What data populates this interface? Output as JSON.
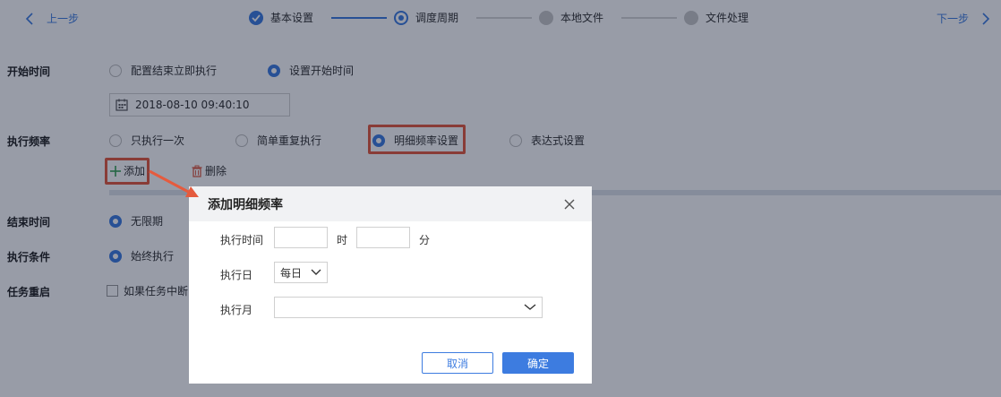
{
  "nav": {
    "prev_label": "上一步",
    "next_label": "下一步"
  },
  "steps": [
    {
      "label": "基本设置",
      "status": "done"
    },
    {
      "label": "调度周期",
      "status": "current"
    },
    {
      "label": "本地文件",
      "status": "todo"
    },
    {
      "label": "文件处理",
      "status": "todo"
    }
  ],
  "form": {
    "start_time": {
      "label": "开始时间",
      "options": [
        {
          "label": "配置结束立即执行",
          "checked": false
        },
        {
          "label": "设置开始时间",
          "checked": true
        }
      ],
      "datetime_value": "2018-08-10 09:40:10"
    },
    "frequency": {
      "label": "执行频率",
      "options": [
        {
          "label": "只执行一次",
          "checked": false
        },
        {
          "label": "简单重复执行",
          "checked": false
        },
        {
          "label": "明细频率设置",
          "checked": true
        },
        {
          "label": "表达式设置",
          "checked": false
        }
      ],
      "add_label": "添加",
      "delete_label": "删除"
    },
    "end_time": {
      "label": "结束时间",
      "option_label": "无限期"
    },
    "condition": {
      "label": "执行条件",
      "option_label": "始终执行"
    },
    "restart": {
      "label": "任务重启",
      "checkbox_label": "如果任务中断"
    }
  },
  "modal": {
    "title": "添加明细频率",
    "exec_time_label": "执行时间",
    "hour_unit": "时",
    "minute_unit": "分",
    "hour_value": "",
    "minute_value": "",
    "exec_day_label": "执行日",
    "exec_day_value": "每日",
    "exec_month_label": "执行月",
    "exec_month_value": "",
    "cancel_label": "取消",
    "ok_label": "确定"
  },
  "colors": {
    "accent": "#3d7ce0",
    "highlight": "#e55b3e",
    "delete_icon": "#e0604a",
    "add_icon": "#3aa356"
  }
}
